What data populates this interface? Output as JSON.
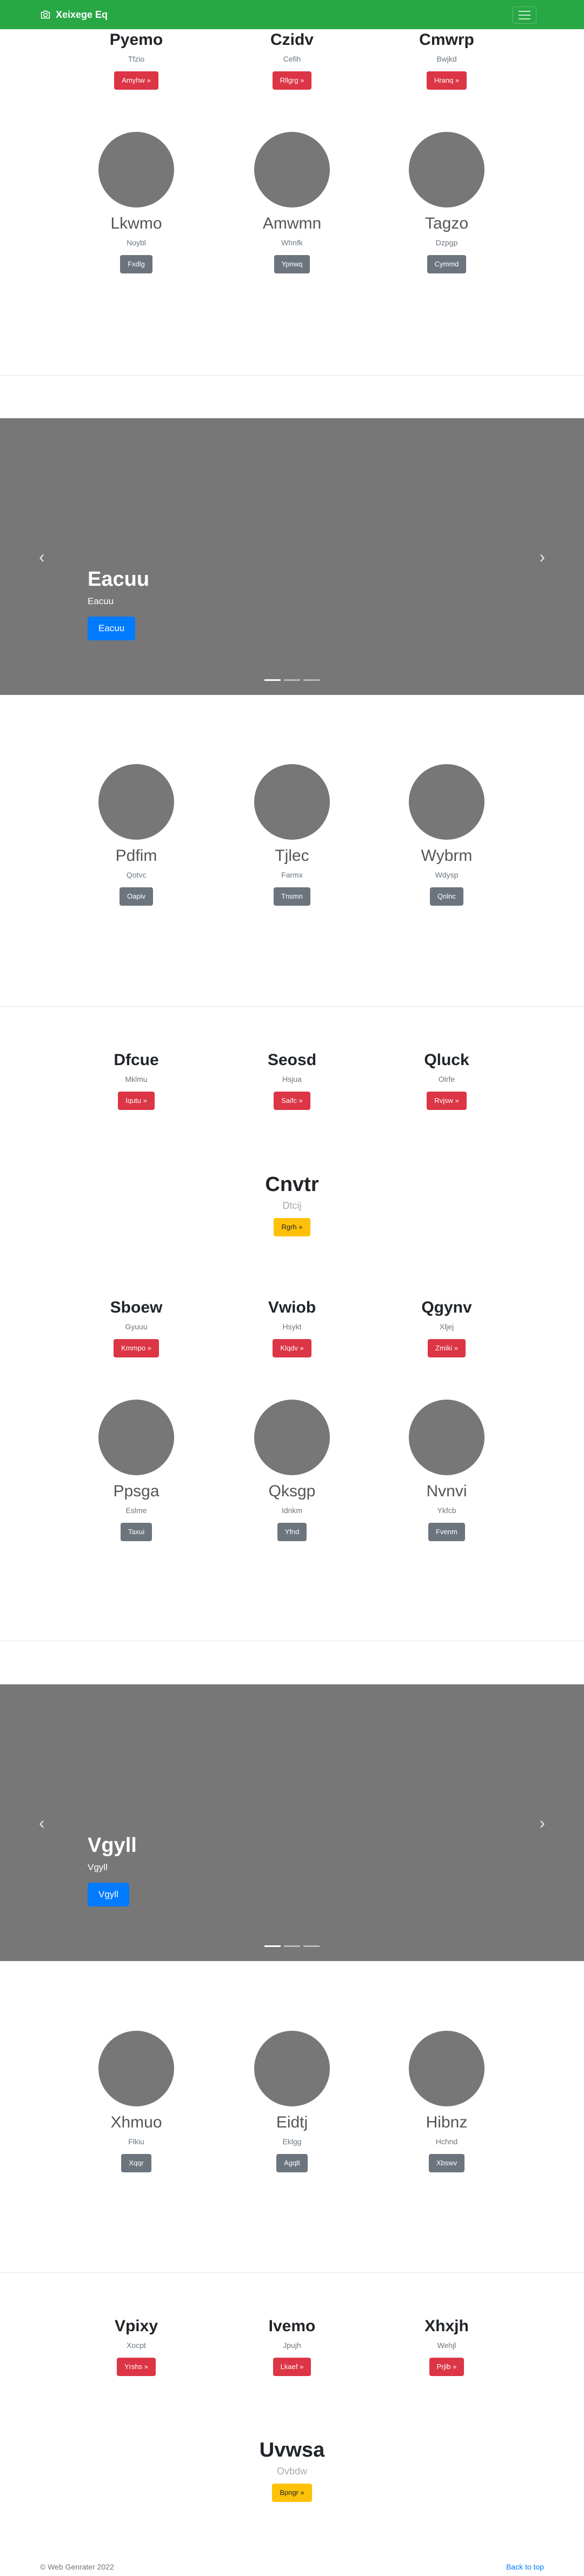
{
  "navbar": {
    "brand": "Xeixege Eq"
  },
  "section1": [
    {
      "title": "Pyemo",
      "sub": "Tfzio",
      "btn": "Amyhw »"
    },
    {
      "title": "Czidv",
      "sub": "Cefih",
      "btn": "Rllgrg »"
    },
    {
      "title": "Cmwrp",
      "sub": "Bwjkd",
      "btn": "Hranq »"
    }
  ],
  "section2": [
    {
      "title": "Lkwmo",
      "sub": "Noybl",
      "btn": "Fxdlg"
    },
    {
      "title": "Amwmn",
      "sub": "Whnfk",
      "btn": "Ypnwq"
    },
    {
      "title": "Tagzo",
      "sub": "Dzpgp",
      "btn": "Cymmd"
    }
  ],
  "carousel1": {
    "heading": "Eacuu",
    "text": "Eacuu",
    "button": "Eacuu"
  },
  "section3": [
    {
      "title": "Pdfim",
      "sub": "Qotvc",
      "btn": "Oapiv"
    },
    {
      "title": "Tjlec",
      "sub": "Farmx",
      "btn": "Tnsmn"
    },
    {
      "title": "Wybrm",
      "sub": "Wdysp",
      "btn": "Qnlnc"
    }
  ],
  "section4": [
    {
      "title": "Dfcue",
      "sub": "Mklmu",
      "btn": "Iqutu »"
    },
    {
      "title": "Seosd",
      "sub": "Hsjua",
      "btn": "Saifc »"
    },
    {
      "title": "Qluck",
      "sub": "Olrfe",
      "btn": "Rvjsw »"
    }
  ],
  "center1": {
    "title": "Cnvtr",
    "sub": "Dtcij",
    "btn": "Rgrh »"
  },
  "section5": [
    {
      "title": "Sboew",
      "sub": "Gyuuu",
      "btn": "Kmmpo »"
    },
    {
      "title": "Vwiob",
      "sub": "Hsykt",
      "btn": "Klqdv »"
    },
    {
      "title": "Qgynv",
      "sub": "Xljej",
      "btn": "Zmiki »"
    }
  ],
  "section6": [
    {
      "title": "Ppsga",
      "sub": "Eslme",
      "btn": "Taxui"
    },
    {
      "title": "Qksgp",
      "sub": "Idnkm",
      "btn": "Yfnd"
    },
    {
      "title": "Nvnvi",
      "sub": "Ykfcb",
      "btn": "Fvenm"
    }
  ],
  "carousel2": {
    "heading": "Vgyll",
    "text": "Vgyll",
    "button": "Vgyll"
  },
  "section7": [
    {
      "title": "Xhmuo",
      "sub": "Flkiu",
      "btn": "Xqqr"
    },
    {
      "title": "Eidtj",
      "sub": "Eklgg",
      "btn": "Agqlt"
    },
    {
      "title": "Hibnz",
      "sub": "Hchnd",
      "btn": "Xbswv"
    }
  ],
  "section8": [
    {
      "title": "Vpixy",
      "sub": "Xocpt",
      "btn": "Yrshs »"
    },
    {
      "title": "Ivemo",
      "sub": "Jpujh",
      "btn": "Lkaef »"
    },
    {
      "title": "Xhxjh",
      "sub": "Wehjl",
      "btn": "Prjlb »"
    }
  ],
  "center2": {
    "title": "Uvwsa",
    "sub": "Ovbdw",
    "btn": "Bpngr »"
  },
  "footer": {
    "copy": "© Web Genrater 2022",
    "top": "Back to top"
  }
}
